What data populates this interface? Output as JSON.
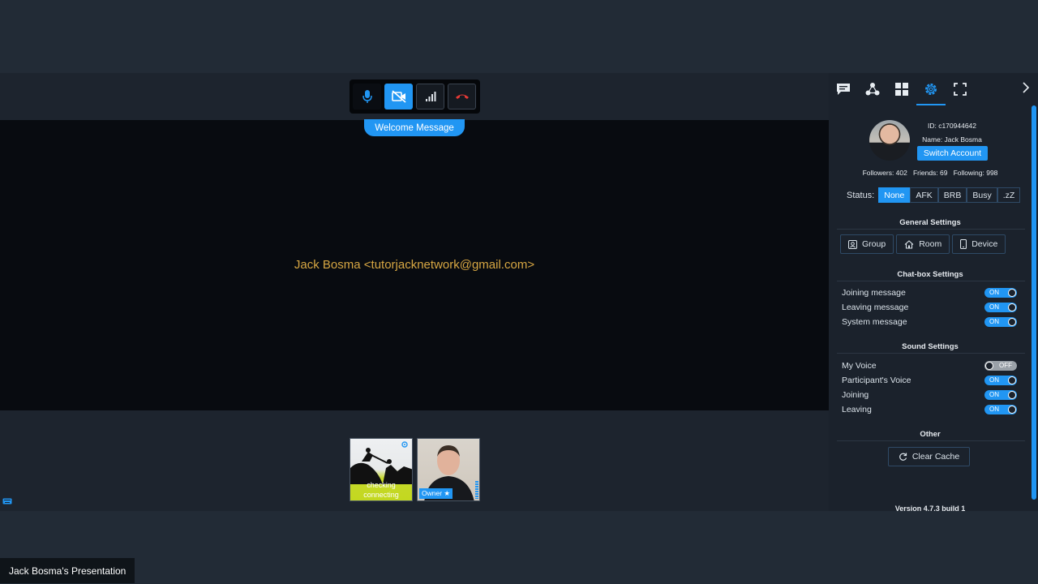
{
  "stage": {
    "presenter_text": "Jack Bosma <tutorjacknetwork@gmail.com>",
    "welcome_button": "Welcome Message",
    "controls": [
      "microphone",
      "video-off",
      "signal",
      "hang-up"
    ]
  },
  "thumbnails": [
    {
      "status_lines": [
        "checking",
        "connecting"
      ]
    },
    {
      "owner_label": "Owner ★"
    }
  ],
  "panel": {
    "tabs": [
      "chat",
      "share",
      "grid",
      "settings",
      "fullscreen"
    ],
    "active_tab": "settings",
    "profile": {
      "id": "ID: c170944642",
      "name": "Name: Jack Bosma",
      "switch_account": "Switch Account",
      "followers": "Followers: 402",
      "friends": "Friends: 69",
      "following": "Following: 998"
    },
    "status": {
      "label": "Status:",
      "options": [
        "None",
        "AFK",
        "BRB",
        "Busy",
        ".zZ"
      ],
      "selected": "None"
    },
    "general": {
      "title": "General Settings",
      "buttons": [
        "Group",
        "Room",
        "Device"
      ]
    },
    "chatbox": {
      "title": "Chat-box Settings",
      "items": [
        {
          "label": "Joining message",
          "state": "ON"
        },
        {
          "label": "Leaving message",
          "state": "ON"
        },
        {
          "label": "System message",
          "state": "ON"
        }
      ]
    },
    "sound": {
      "title": "Sound Settings",
      "items": [
        {
          "label": "My Voice",
          "state": "OFF"
        },
        {
          "label": "Participant's Voice",
          "state": "ON"
        },
        {
          "label": "Joining",
          "state": "ON"
        },
        {
          "label": "Leaving",
          "state": "ON"
        }
      ]
    },
    "other": {
      "title": "Other",
      "clear_cache": "Clear Cache"
    },
    "version": "Version 4.7.3 build 1"
  },
  "presentation_label": "Jack Bosma's Presentation",
  "colors": {
    "accent": "#2196f3",
    "presenter_text": "#d7a743",
    "hangup": "#e53935"
  }
}
